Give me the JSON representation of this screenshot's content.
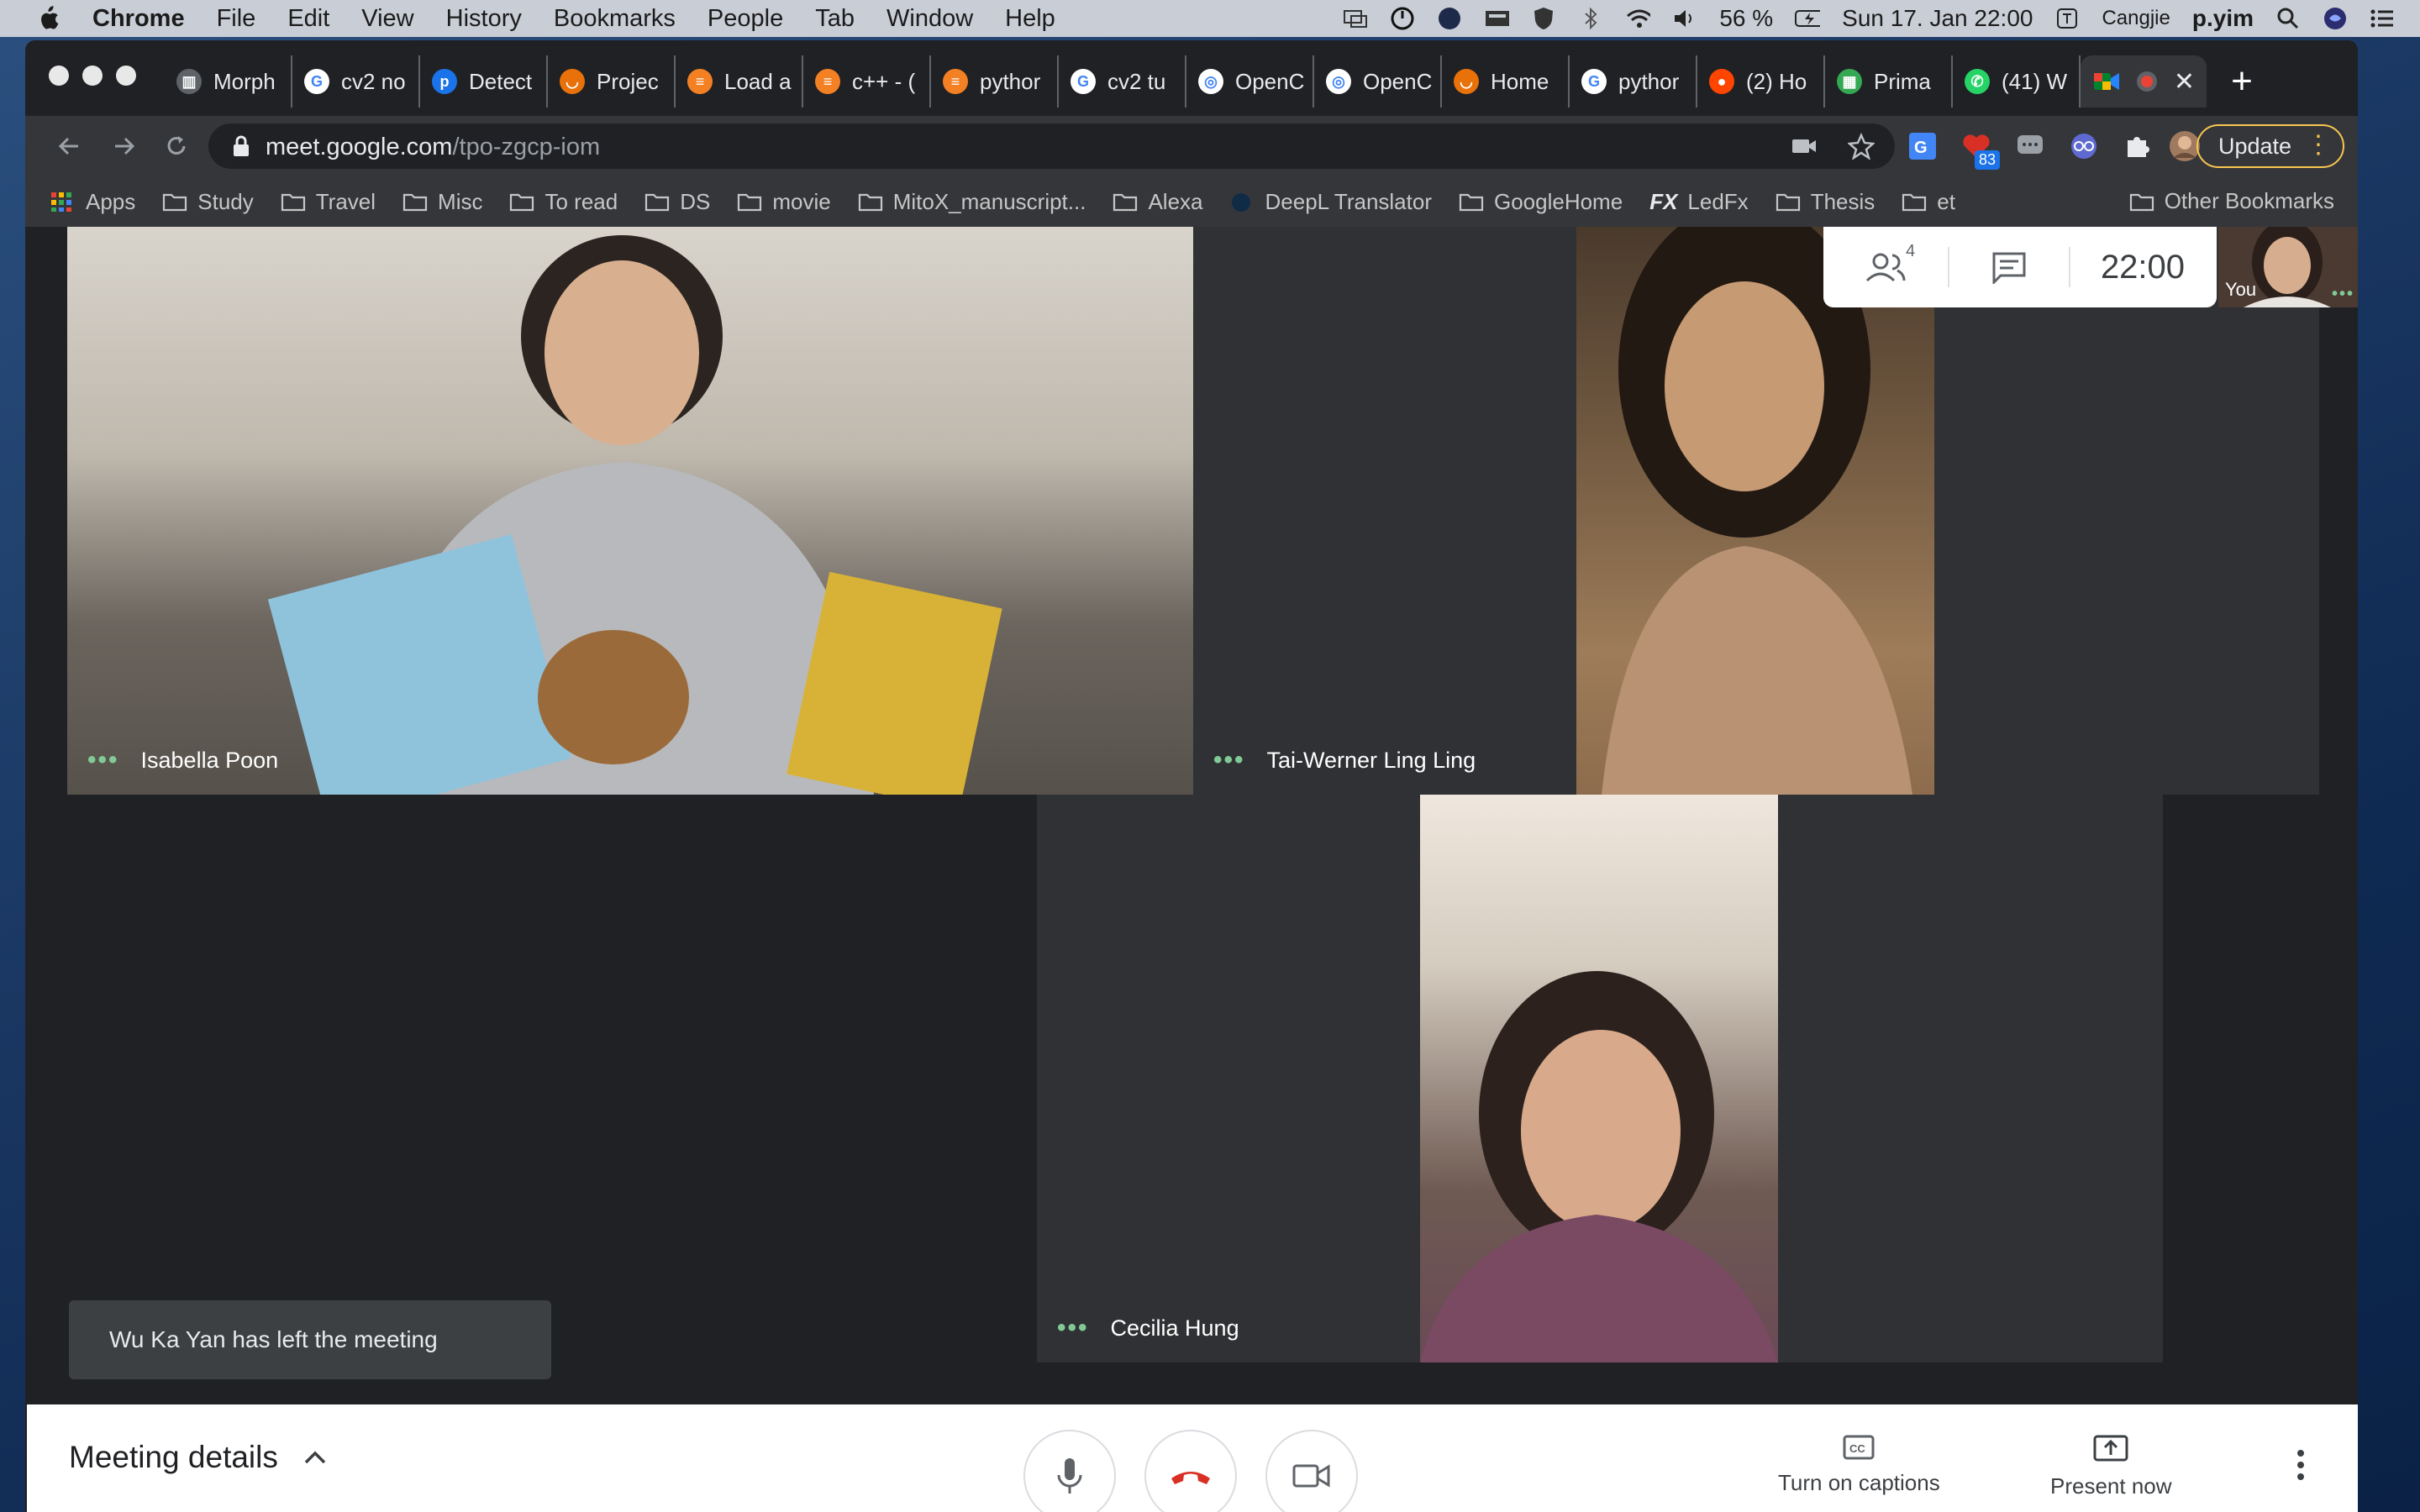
{
  "menubar": {
    "app": "Chrome",
    "items": [
      "File",
      "Edit",
      "View",
      "History",
      "Bookmarks",
      "People",
      "Tab",
      "Window",
      "Help"
    ],
    "battery": "56 %",
    "datetime": "Sun 17. Jan  22:00",
    "input_method": "Cangjie",
    "user": "p.yim"
  },
  "tabs": [
    {
      "title": "Morph",
      "fav_color": "#5f6368",
      "fav_char": "▥"
    },
    {
      "title": "cv2 no",
      "fav_color": "#ffffff",
      "fav_char": "G"
    },
    {
      "title": "Detect",
      "fav_color": "#1a73e8",
      "fav_char": "p"
    },
    {
      "title": "Projec",
      "fav_color": "#e8710a",
      "fav_char": "◡"
    },
    {
      "title": "Load a",
      "fav_color": "#f48024",
      "fav_char": "≡"
    },
    {
      "title": "c++ - (",
      "fav_color": "#f48024",
      "fav_char": "≡"
    },
    {
      "title": "pythor",
      "fav_color": "#f48024",
      "fav_char": "≡"
    },
    {
      "title": "cv2 tu",
      "fav_color": "#ffffff",
      "fav_char": "G"
    },
    {
      "title": "OpenC",
      "fav_color": "#ffffff",
      "fav_char": "◎"
    },
    {
      "title": "OpenC",
      "fav_color": "#ffffff",
      "fav_char": "◎"
    },
    {
      "title": "Home",
      "fav_color": "#e8710a",
      "fav_char": "◡"
    },
    {
      "title": "pythor",
      "fav_color": "#ffffff",
      "fav_char": "G"
    },
    {
      "title": "(2) Ho",
      "fav_color": "#ff4500",
      "fav_char": "●"
    },
    {
      "title": "Prima",
      "fav_color": "#34a853",
      "fav_char": "▦"
    },
    {
      "title": "(41) W",
      "fav_color": "#25d366",
      "fav_char": "✆"
    }
  ],
  "address": {
    "domain": "meet.google.com",
    "path": "/tpo-zgcp-iom"
  },
  "update_label": "Update",
  "extensions": {
    "badge": "83"
  },
  "bookmarks": [
    {
      "label": "Apps",
      "type": "apps"
    },
    {
      "label": "Study",
      "type": "folder"
    },
    {
      "label": "Travel",
      "type": "folder"
    },
    {
      "label": "Misc",
      "type": "folder"
    },
    {
      "label": "To read",
      "type": "folder"
    },
    {
      "label": "DS",
      "type": "folder"
    },
    {
      "label": "movie",
      "type": "folder"
    },
    {
      "label": "MitoX_manuscript...",
      "type": "folder"
    },
    {
      "label": "Alexa",
      "type": "folder"
    },
    {
      "label": "DeepL Translator",
      "type": "site"
    },
    {
      "label": "GoogleHome",
      "type": "folder"
    },
    {
      "label": "LedFx",
      "type": "fx"
    },
    {
      "label": "Thesis",
      "type": "folder"
    },
    {
      "label": "et",
      "type": "folder"
    }
  ],
  "other_bookmarks": "Other Bookmarks",
  "participants": [
    {
      "name": "Isabella Poon"
    },
    {
      "name": "Tai-Werner Ling Ling"
    },
    {
      "name": "Cecilia Hung"
    }
  ],
  "people_count": "4",
  "clock": "22:00",
  "self_label": "You",
  "toast": "Wu Ka Yan has left the meeting",
  "bottom": {
    "meeting_details": "Meeting details",
    "captions": "Turn on captions",
    "present": "Present now"
  },
  "colors": {
    "hangup": "#d93025",
    "speaking_dots": "#81c995",
    "update_border": "#f9c650"
  }
}
